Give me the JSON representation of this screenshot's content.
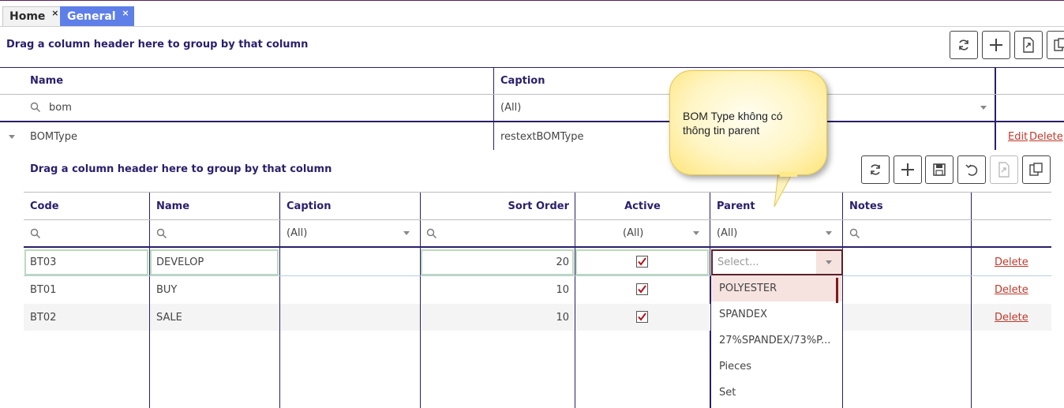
{
  "tabs": [
    {
      "label": "Home",
      "close": "×"
    },
    {
      "label": "General",
      "close": "×"
    }
  ],
  "outer": {
    "group_hint": "Drag a column header here to group by that column",
    "columns": {
      "name": "Name",
      "caption": "Caption"
    },
    "filter": {
      "name_value": "bom",
      "caption_value": "(All)"
    },
    "row": {
      "name": "BOMType",
      "caption": "restextBOMType",
      "edit": "Edit",
      "delete": "Delete"
    }
  },
  "inner": {
    "group_hint": "Drag a column header here to group by that column",
    "columns": {
      "code": "Code",
      "name": "Name",
      "caption": "Caption",
      "sort_order": "Sort Order",
      "active": "Active",
      "parent": "Parent",
      "notes": "Notes"
    },
    "filters": {
      "caption": "(All)",
      "active": "(All)",
      "parent": "(All)"
    },
    "rows": [
      {
        "code": "BT03",
        "name": "DEVELOP",
        "caption": "",
        "sort_order": "20",
        "active": true,
        "parent_placeholder": "Select...",
        "delete": "Delete"
      },
      {
        "code": "BT01",
        "name": "BUY",
        "caption": "",
        "sort_order": "10",
        "active": true,
        "delete": "Delete"
      },
      {
        "code": "BT02",
        "name": "SALE",
        "caption": "",
        "sort_order": "10",
        "active": true,
        "delete": "Delete"
      }
    ],
    "parent_options": [
      "POLYESTER",
      "SPANDEX",
      "27%SPANDEX/73%P...",
      "Pieces",
      "Set"
    ]
  },
  "tooltip": {
    "text_line1": "BOM Type không có",
    "text_line2": "thông tin parent"
  },
  "colors": {
    "accent": "#2a1f6b",
    "tab_active": "#5e7fe8",
    "link": "#c0392b",
    "edit_border": "#bcd9bc",
    "tooltip_fill": "#fff5c4"
  },
  "icons": {
    "outer_toolbar": [
      "refresh-icon",
      "plus-icon",
      "export-icon",
      "columns-icon"
    ],
    "inner_toolbar": [
      "refresh-icon",
      "plus-icon",
      "save-icon",
      "undo-icon",
      "export-icon",
      "columns-icon"
    ]
  }
}
